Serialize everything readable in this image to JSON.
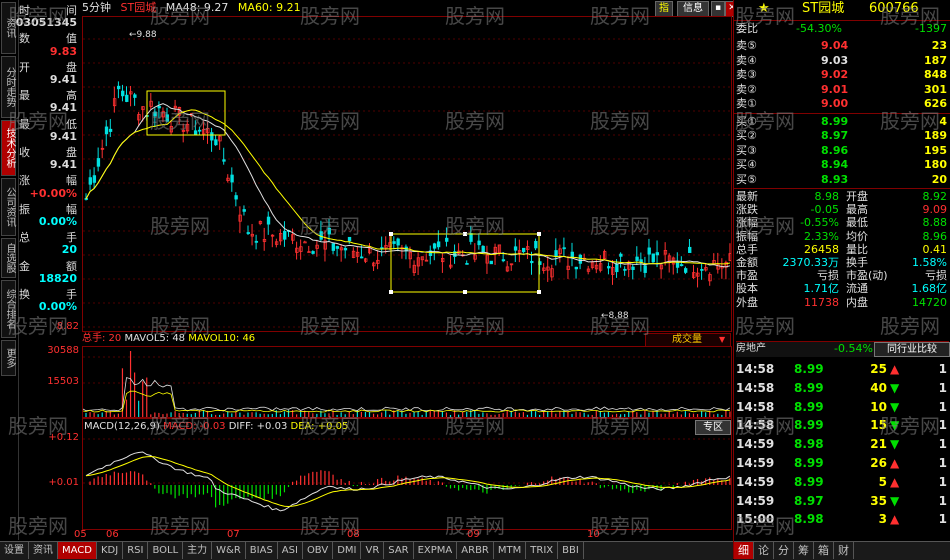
{
  "left_tabs": [
    "资讯",
    "分时走势",
    "技术分析",
    "公司资讯",
    "自选股",
    "综合排名",
    "更多"
  ],
  "info": [
    {
      "label": "时",
      "value": "间"
    },
    {
      "label": "",
      "value": "03051345"
    },
    {
      "label": "数",
      "value": "值"
    },
    {
      "label": "",
      "value": "9.83"
    },
    {
      "label": "开",
      "value": "盘"
    },
    {
      "label": "",
      "value": "9.41"
    },
    {
      "label": "最",
      "value": "高"
    },
    {
      "label": "",
      "value": "9.41"
    },
    {
      "label": "最",
      "value": "低"
    },
    {
      "label": "",
      "value": "9.41"
    },
    {
      "label": "收",
      "value": "盘"
    },
    {
      "label": "",
      "value": "9.41"
    },
    {
      "label": "涨",
      "value": "幅"
    },
    {
      "label": "",
      "value": "+0.00%"
    },
    {
      "label": "振",
      "value": "幅"
    },
    {
      "label": "",
      "value": "0.00%"
    },
    {
      "label": "总",
      "value": "手"
    },
    {
      "label": "",
      "value": "20"
    },
    {
      "label": "金",
      "value": "额"
    },
    {
      "label": "",
      "value": "18820"
    },
    {
      "label": "换",
      "value": "手"
    },
    {
      "label": "",
      "value": "0.00%"
    }
  ],
  "header": {
    "period": "5分钟",
    "name": "ST园城",
    "ma1": "MA48: 9.27",
    "ma2": "MA60: 9.21"
  },
  "header_buttons": [
    "指",
    "信息"
  ],
  "price_axis": {
    "top": "8.82",
    "low": "8.82"
  },
  "annotations": {
    "high": "9.88",
    "low": "8.88"
  },
  "vol_header": {
    "total": "总手: 20",
    "ma5": "MAVOL5: 48",
    "ma10": "MAVOL10: 46",
    "dropdown": "成交量"
  },
  "vol_axis": [
    "30588",
    "15503"
  ],
  "macd_header": {
    "params": "MACD(12,26,9)",
    "macd": "MACD: -0.03",
    "diff": "DIFF: +0.03",
    "dea": "DEA: +0.05",
    "zone_btn": "专区"
  },
  "macd_axis": [
    "+0.12",
    "+0.01"
  ],
  "x_labels": [
    "05",
    "06",
    "07",
    "08",
    "09",
    "10"
  ],
  "stock": {
    "name": "ST园城",
    "code": "600766"
  },
  "book": {
    "ratio_label": "委比",
    "ratio": "-54.30%",
    "diff": "-1397",
    "asks": [
      {
        "label": "卖⑤",
        "price": "9.04",
        "vol": "23"
      },
      {
        "label": "卖④",
        "price": "9.03",
        "vol": "187"
      },
      {
        "label": "卖③",
        "price": "9.02",
        "vol": "848"
      },
      {
        "label": "卖②",
        "price": "9.01",
        "vol": "301"
      },
      {
        "label": "卖①",
        "price": "9.00",
        "vol": "626"
      }
    ],
    "bids": [
      {
        "label": "买①",
        "price": "8.99",
        "vol": "4"
      },
      {
        "label": "买②",
        "price": "8.97",
        "vol": "189"
      },
      {
        "label": "买③",
        "price": "8.96",
        "vol": "195"
      },
      {
        "label": "买④",
        "price": "8.94",
        "vol": "180"
      },
      {
        "label": "买⑤",
        "price": "8.93",
        "vol": "20"
      }
    ]
  },
  "quote": [
    {
      "l1": "最新",
      "v1": "8.98",
      "l2": "开盘",
      "v2": "8.92"
    },
    {
      "l1": "涨跌",
      "v1": "-0.05",
      "l2": "最高",
      "v2": "9.09"
    },
    {
      "l1": "涨幅",
      "v1": "-0.55%",
      "l2": "最低",
      "v2": "8.88"
    },
    {
      "l1": "振幅",
      "v1": "2.33%",
      "l2": "均价",
      "v2": "8.96"
    },
    {
      "l1": "总手",
      "v1": "26458",
      "l2": "量比",
      "v2": "0.41"
    },
    {
      "l1": "金额",
      "v1": "2370.33万",
      "l2": "换手",
      "v2": "1.58%"
    },
    {
      "l1": "市盈",
      "v1": "亏损",
      "l2": "市盈(动)",
      "v2": "亏损"
    },
    {
      "l1": "股本",
      "v1": "1.71亿",
      "l2": "流通",
      "v2": "1.68亿"
    },
    {
      "l1": "外盘",
      "v1": "11738",
      "l2": "内盘",
      "v2": "14720"
    }
  ],
  "sector": {
    "name": "房地产",
    "change": "-0.54%",
    "button": "同行业比较"
  },
  "ticks": [
    {
      "time": "14:58",
      "price": "8.99",
      "vol": "25",
      "dir": "up",
      "n": "1"
    },
    {
      "time": "14:58",
      "price": "8.99",
      "vol": "40",
      "dir": "down",
      "n": "1"
    },
    {
      "time": "14:58",
      "price": "8.99",
      "vol": "10",
      "dir": "down",
      "n": "1"
    },
    {
      "time": "14:58",
      "price": "8.99",
      "vol": "15",
      "dir": "down",
      "n": "1"
    },
    {
      "time": "14:59",
      "price": "8.98",
      "vol": "21",
      "dir": "down",
      "n": "1"
    },
    {
      "time": "14:59",
      "price": "8.99",
      "vol": "26",
      "dir": "up",
      "n": "1"
    },
    {
      "time": "14:59",
      "price": "8.99",
      "vol": "5",
      "dir": "up",
      "n": "1"
    },
    {
      "time": "14:59",
      "price": "8.97",
      "vol": "35",
      "dir": "down",
      "n": "1"
    },
    {
      "time": "15:00",
      "price": "8.98",
      "vol": "3",
      "dir": "up",
      "n": "1"
    }
  ],
  "right_tabs": [
    "细",
    "论",
    "分",
    "筹",
    "箱",
    "财"
  ],
  "bottom_tabs": [
    "设置",
    "资讯",
    "MACD",
    "KDJ",
    "RSI",
    "BOLL",
    "主力",
    "W&R",
    "BIAS",
    "ASI",
    "OBV",
    "DMI",
    "VR",
    "SAR",
    "EXPMA",
    "ARBR",
    "MTM",
    "TRIX",
    "BBI"
  ],
  "watermark": "股旁网",
  "colors": {
    "up": "#ff3030",
    "down": "#00e000",
    "frame": "#800000",
    "ma_white": "#e0e0e0",
    "ma_yellow": "#ffff00"
  }
}
